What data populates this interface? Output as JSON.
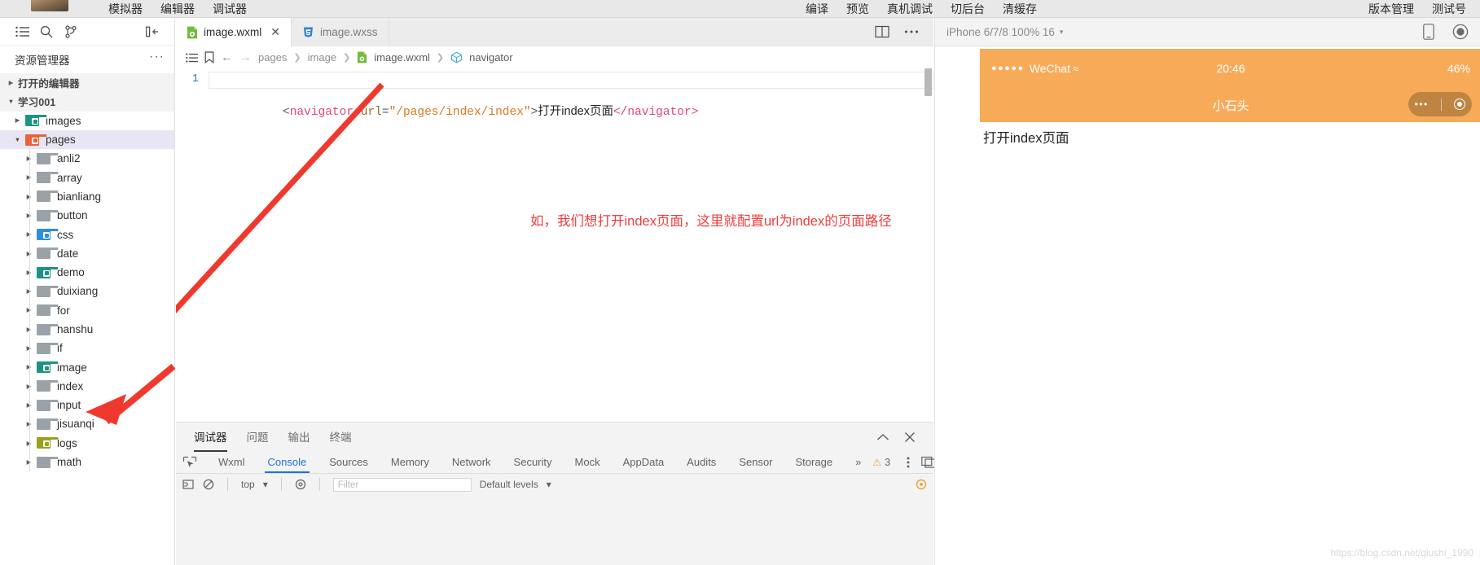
{
  "topbar": {
    "left_menu": [
      "模拟器",
      "编辑器",
      "调试器"
    ],
    "center_menu": [
      "编译",
      "预览",
      "真机调试",
      "切后台",
      "清缓存"
    ],
    "right_menu": [
      "版本管理",
      "测试号"
    ]
  },
  "sidebar": {
    "toolbar_icons": [
      "list-icon",
      "search-icon",
      "source-control-icon",
      "collapse-panel-icon"
    ],
    "title": "资源管理器",
    "more_label": "···",
    "tree": [
      {
        "label": "打开的编辑器",
        "level": 0,
        "type": "section",
        "expanded": false,
        "icon": "none"
      },
      {
        "label": "学习001",
        "level": 0,
        "type": "section",
        "expanded": true,
        "icon": "none"
      },
      {
        "label": "images",
        "level": 1,
        "type": "folder",
        "expanded": false,
        "icon": "folder-green"
      },
      {
        "label": "pages",
        "level": 1,
        "type": "folder",
        "expanded": true,
        "icon": "folder-red",
        "selected": true
      },
      {
        "label": "anli2",
        "level": 2,
        "type": "folder",
        "expanded": false,
        "icon": "folder-grey"
      },
      {
        "label": "array",
        "level": 2,
        "type": "folder",
        "expanded": false,
        "icon": "folder-grey"
      },
      {
        "label": "bianliang",
        "level": 2,
        "type": "folder",
        "expanded": false,
        "icon": "folder-grey"
      },
      {
        "label": "button",
        "level": 2,
        "type": "folder",
        "expanded": false,
        "icon": "folder-grey"
      },
      {
        "label": "css",
        "level": 2,
        "type": "folder",
        "expanded": false,
        "icon": "folder-blue"
      },
      {
        "label": "date",
        "level": 2,
        "type": "folder",
        "expanded": false,
        "icon": "folder-grey"
      },
      {
        "label": "demo",
        "level": 2,
        "type": "folder",
        "expanded": false,
        "icon": "folder-green"
      },
      {
        "label": "duixiang",
        "level": 2,
        "type": "folder",
        "expanded": false,
        "icon": "folder-grey"
      },
      {
        "label": "for",
        "level": 2,
        "type": "folder",
        "expanded": false,
        "icon": "folder-grey"
      },
      {
        "label": "hanshu",
        "level": 2,
        "type": "folder",
        "expanded": false,
        "icon": "folder-grey"
      },
      {
        "label": "if",
        "level": 2,
        "type": "folder",
        "expanded": false,
        "icon": "folder-grey"
      },
      {
        "label": "image",
        "level": 2,
        "type": "folder",
        "expanded": false,
        "icon": "folder-green"
      },
      {
        "label": "index",
        "level": 2,
        "type": "folder",
        "expanded": false,
        "icon": "folder-grey"
      },
      {
        "label": "input",
        "level": 2,
        "type": "folder",
        "expanded": false,
        "icon": "folder-grey"
      },
      {
        "label": "jisuanqi",
        "level": 2,
        "type": "folder",
        "expanded": false,
        "icon": "folder-grey"
      },
      {
        "label": "logs",
        "level": 2,
        "type": "folder",
        "expanded": false,
        "icon": "folder-olive"
      },
      {
        "label": "math",
        "level": 2,
        "type": "folder",
        "expanded": false,
        "icon": "folder-grey"
      }
    ]
  },
  "editor": {
    "tabs": [
      {
        "label": "image.wxml",
        "icon": "wxml-file-icon",
        "active": true,
        "closable": true
      },
      {
        "label": "image.wxss",
        "icon": "wxss-file-icon",
        "active": false,
        "closable": false
      }
    ],
    "tab_close_glyph": "✕",
    "tools": [
      "split-editor-icon",
      "more-actions-icon"
    ],
    "breadcrumb": {
      "icons": [
        "outline-icon",
        "bookmark-icon",
        "back-arrow-icon",
        "forward-arrow-icon"
      ],
      "crumbs": [
        "pages",
        "image",
        "image.wxml",
        "navigator"
      ],
      "file_icon": "wxml-file-icon",
      "symbol_icon": "element-symbol-icon"
    },
    "code": {
      "line_number": "1",
      "tokens": [
        {
          "t": "<",
          "k": "punct"
        },
        {
          "t": "navigator",
          "k": "tag"
        },
        {
          "t": " ",
          "k": "plain"
        },
        {
          "t": "url",
          "k": "attr"
        },
        {
          "t": "=",
          "k": "punct"
        },
        {
          "t": "\"/pages/index/index\"",
          "k": "str"
        },
        {
          "t": ">",
          "k": "punct"
        },
        {
          "t": "打开index页面",
          "k": "text"
        },
        {
          "t": "</",
          "k": "punct"
        },
        {
          "t": "navigator",
          "k": "tag"
        },
        {
          "t": ">",
          "k": "punct"
        }
      ],
      "full_text": "<navigator url=\"/pages/index/index\">打开index页面</navigator>"
    },
    "annotation": {
      "text": "如，我们想打开index页面，这里就配置url为index的页面路径",
      "color": "#ef3d3d",
      "arrow": "red-arrow-pointing-to-index-folder"
    }
  },
  "debugger": {
    "tabs": [
      {
        "label": "调试器",
        "active": true
      },
      {
        "label": "问题",
        "active": false
      },
      {
        "label": "输出",
        "active": false
      },
      {
        "label": "终端",
        "active": false
      }
    ],
    "header_icons": [
      "chevron-up-icon",
      "close-icon"
    ],
    "devtools_tabs": [
      {
        "label": "Wxml",
        "active": false
      },
      {
        "label": "Console",
        "active": true
      },
      {
        "label": "Sources",
        "active": false
      },
      {
        "label": "Memory",
        "active": false
      },
      {
        "label": "Network",
        "active": false
      },
      {
        "label": "Security",
        "active": false
      },
      {
        "label": "Mock",
        "active": false
      },
      {
        "label": "AppData",
        "active": false
      },
      {
        "label": "Audits",
        "active": false
      },
      {
        "label": "Sensor",
        "active": false
      },
      {
        "label": "Storage",
        "active": false
      }
    ],
    "overflow_glyph": "»",
    "warning_count": "3",
    "warning_glyph": "⚠",
    "inspect_icon": "inspect-element-icon",
    "more_icon": "devtools-more-icon",
    "dock_icon": "dock-side-icon",
    "console_filter_placeholder": "Filter",
    "console_level": "Default levels",
    "console_level_caret": "▾",
    "console_icons": [
      "clear-console-icon",
      "no-entry-icon",
      "settings-gear-icon"
    ],
    "context_label": "top"
  },
  "simulator": {
    "device_label": "iPhone 6/7/8 100% 16",
    "device_caret": "▾",
    "icons": [
      "device-rotate-icon",
      "record-icon"
    ],
    "status_bar": {
      "signal_dots": "●●●●●",
      "carrier": "WeChat",
      "wifi_glyph": "≈",
      "time": "20:46",
      "battery": "46%"
    },
    "nav_bar": {
      "title": "小石头",
      "capsule_dots": "•••",
      "capsule_target": "target-icon"
    },
    "page": {
      "link_text": "打开index页面"
    }
  },
  "watermark": "https://blog.csdn.net/qiushi_1990"
}
